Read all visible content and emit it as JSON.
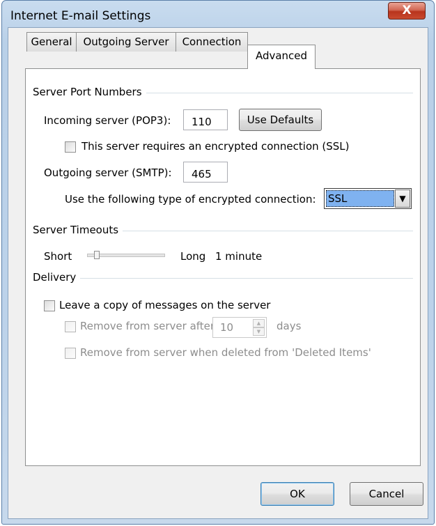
{
  "window": {
    "title": "Internet E-mail Settings",
    "close_label": "X"
  },
  "tabs": [
    {
      "label": "General"
    },
    {
      "label": "Outgoing Server"
    },
    {
      "label": "Connection"
    },
    {
      "label": "Advanced"
    }
  ],
  "active_tab": "Advanced",
  "server_ports": {
    "group_label": "Server Port Numbers",
    "incoming_label": "Incoming server (POP3):",
    "incoming_value": "110",
    "use_defaults_label": "Use Defaults",
    "ssl_checkbox_label": "This server requires an encrypted connection (SSL)",
    "ssl_checked": false,
    "outgoing_label": "Outgoing server (SMTP):",
    "outgoing_value": "465",
    "encryption_label": "Use the following type of encrypted connection:",
    "encryption_value": "SSL"
  },
  "timeouts": {
    "group_label": "Server Timeouts",
    "short_label": "Short",
    "long_label": "Long",
    "value_label": "1 minute",
    "slider_level": 0.1
  },
  "delivery": {
    "group_label": "Delivery",
    "leave_copy_label": "Leave a copy of messages on the server",
    "leave_copy_checked": false,
    "remove_after_label": "Remove from server after",
    "remove_after_value": "10",
    "days_label": "days",
    "remove_deleted_label": "Remove from server when deleted from 'Deleted Items'"
  },
  "footer": {
    "ok_label": "OK",
    "cancel_label": "Cancel"
  },
  "colors": {
    "accent_selection": "#7fb2f0",
    "close_button": "#c84a2f"
  },
  "icons": {
    "close": "close-icon",
    "dropdown": "chevron-down-icon",
    "spin_up": "spin-up-icon",
    "spin_down": "spin-down-icon"
  }
}
